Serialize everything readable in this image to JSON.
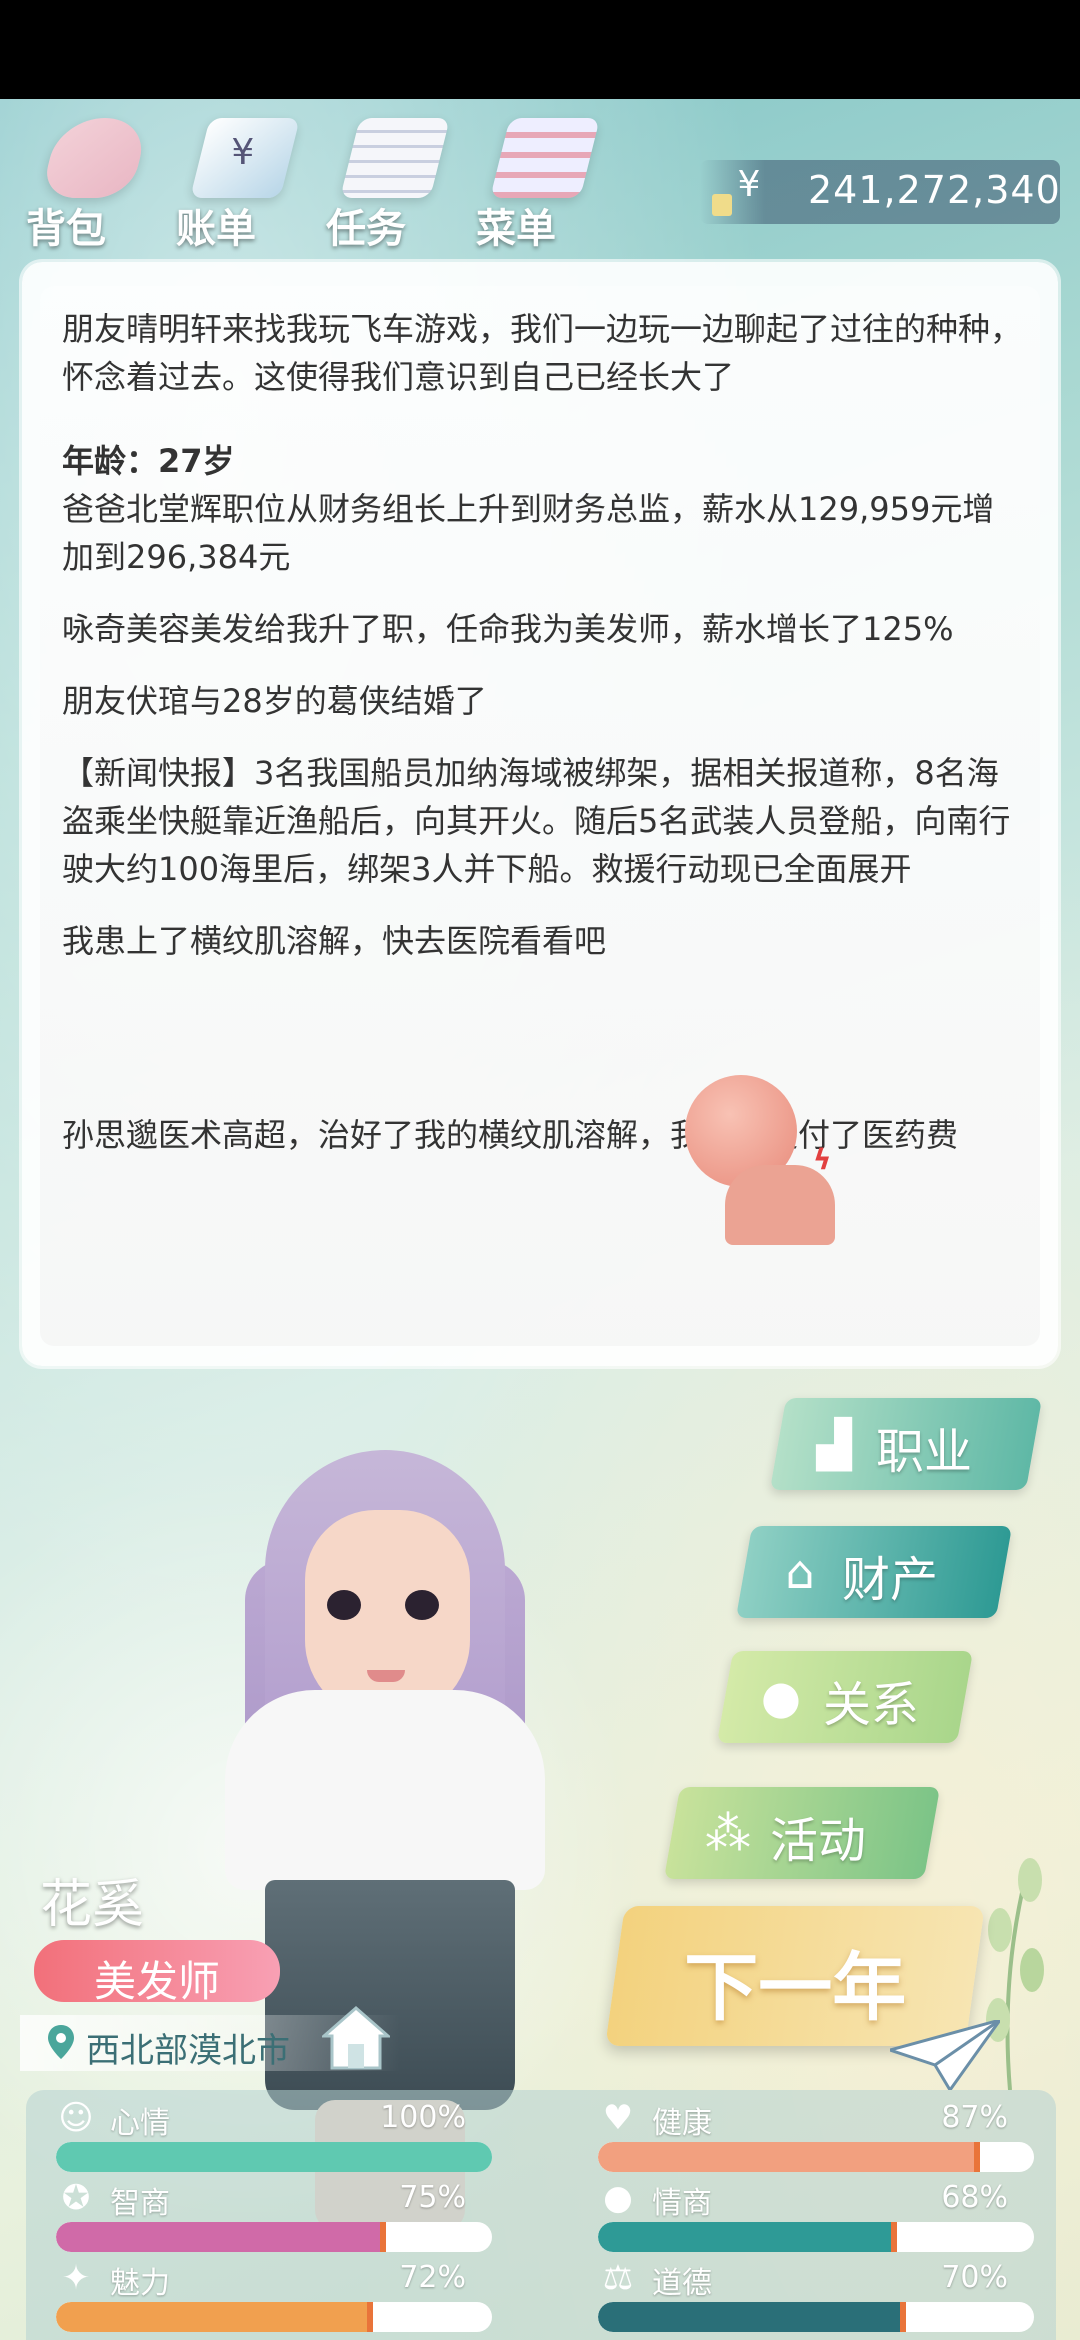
{
  "top_menu": {
    "bag": "背包",
    "bill": "账单",
    "task": "任务",
    "menu": "菜单"
  },
  "money": {
    "currency_icon": "¥",
    "amount": "241,272,340"
  },
  "events": [
    "朋友晴明轩来找我玩飞车游戏，我们一边玩一边聊起了过往的种种，怀念着过去。这使得我们意识到自己已经长大了",
    "年龄：27岁",
    "爸爸北堂辉职位从财务组长上升到财务总监，薪水从129,959元增加到296,384元",
    "咏奇美容美发给我升了职，任命我为美发师，薪水增长了125%",
    "朋友伏琯与28岁的葛侠结婚了",
    "【新闻快报】3名我国船员加纳海域被绑架，据相关报道称，8名海盗乘坐快艇靠近渔船后，向其开火。随后5名武装人员登船，向南行驶大约100海里后，绑架3人并下船。救援行动现已全面展开",
    "我患上了横纹肌溶解，快去医院看看吧",
    "孙思邈医术高超，治好了我的横纹肌溶解，我自己支付了医药费"
  ],
  "actions": {
    "career": "职业",
    "asset": "财产",
    "relation": "关系",
    "activity": "活动",
    "next_year": "下一年"
  },
  "character": {
    "name": "花奚",
    "job": "美发师",
    "location": "西北部漠北市"
  },
  "stats": [
    {
      "label": "心情",
      "value": "100%",
      "level": 1.0,
      "color": "#5fc9b1",
      "icon": "smile-icon"
    },
    {
      "label": "健康",
      "value": "87%",
      "level": 0.87,
      "color": "#f2a07f",
      "icon": "heart-icon"
    },
    {
      "label": "智商",
      "value": "75%",
      "level": 0.75,
      "color": "#d06aa8",
      "icon": "bulb-icon"
    },
    {
      "label": "情商",
      "value": "68%",
      "level": 0.68,
      "color": "#2e9a96",
      "icon": "apple-icon"
    },
    {
      "label": "魅力",
      "value": "72%",
      "level": 0.72,
      "color": "#f1a04f",
      "icon": "star-icon"
    },
    {
      "label": "道德",
      "value": "70%",
      "level": 0.7,
      "color": "#2a6f78",
      "icon": "scale-icon"
    }
  ]
}
